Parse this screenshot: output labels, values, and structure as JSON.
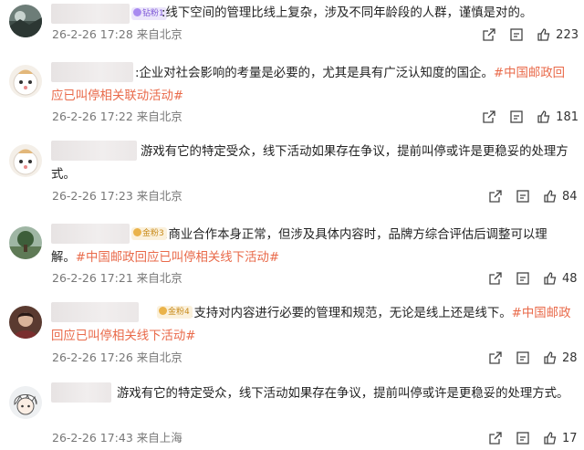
{
  "comments": [
    {
      "badge": "钻粉1",
      "badge_style": "purple",
      "text_prefix": ":",
      "text": "线下空间的管理比线上复杂，涉及不同年龄段的人群，谨慎是对的。",
      "hashtag": "",
      "date": "26-2-26 17:28",
      "location": "来自北京",
      "likes": "223",
      "avatar": "landscape-avatar"
    },
    {
      "badge": "",
      "badge_style": "",
      "text_prefix": ":",
      "text": "企业对社会影响的考量是必要的，尤其是具有广泛认知度的国企。",
      "hashtag": "#中国邮政回应已叫停相关联动活动#",
      "date": "26-2-26 17:22",
      "location": "来自北京",
      "likes": "181",
      "avatar": "sheep-avatar"
    },
    {
      "badge": "",
      "badge_style": "",
      "text_prefix": "",
      "text": "游戏有它的特定受众，线下活动如果存在争议，提前叫停或许是更稳妥的处理方式。",
      "hashtag": "",
      "date": "26-2-26 17:23",
      "location": "来自北京",
      "likes": "84",
      "avatar": "sheep-avatar"
    },
    {
      "badge": "金粉3",
      "badge_style": "gold",
      "text_prefix": ":",
      "text": "商业合作本身正常，但涉及具体内容时，品牌方综合评估后调整可以理解。",
      "hashtag": "#中国邮政回应已叫停相关线下活动#",
      "date": "26-2-26 17:21",
      "location": "来自北京",
      "likes": "48",
      "avatar": "tree-avatar"
    },
    {
      "badge": "金粉4",
      "badge_style": "gold",
      "text_prefix": ":",
      "text": "支持对内容进行必要的管理和规范，无论是线上还是线下。",
      "hashtag": "#中国邮政回应已叫停相关线下活动#",
      "date": "26-2-26 17:26",
      "location": "来自北京",
      "likes": "28",
      "avatar": "portrait-avatar"
    },
    {
      "badge": "",
      "badge_style": "",
      "text_prefix": "",
      "text": "游戏有它的特定受众，线下活动如果存在争议，提前叫停或许是更稳妥的处理方式。",
      "hashtag": "",
      "date": "26-2-26 17:43",
      "location": "来自上海",
      "likes": "17",
      "avatar": "cartoon-avatar"
    }
  ]
}
